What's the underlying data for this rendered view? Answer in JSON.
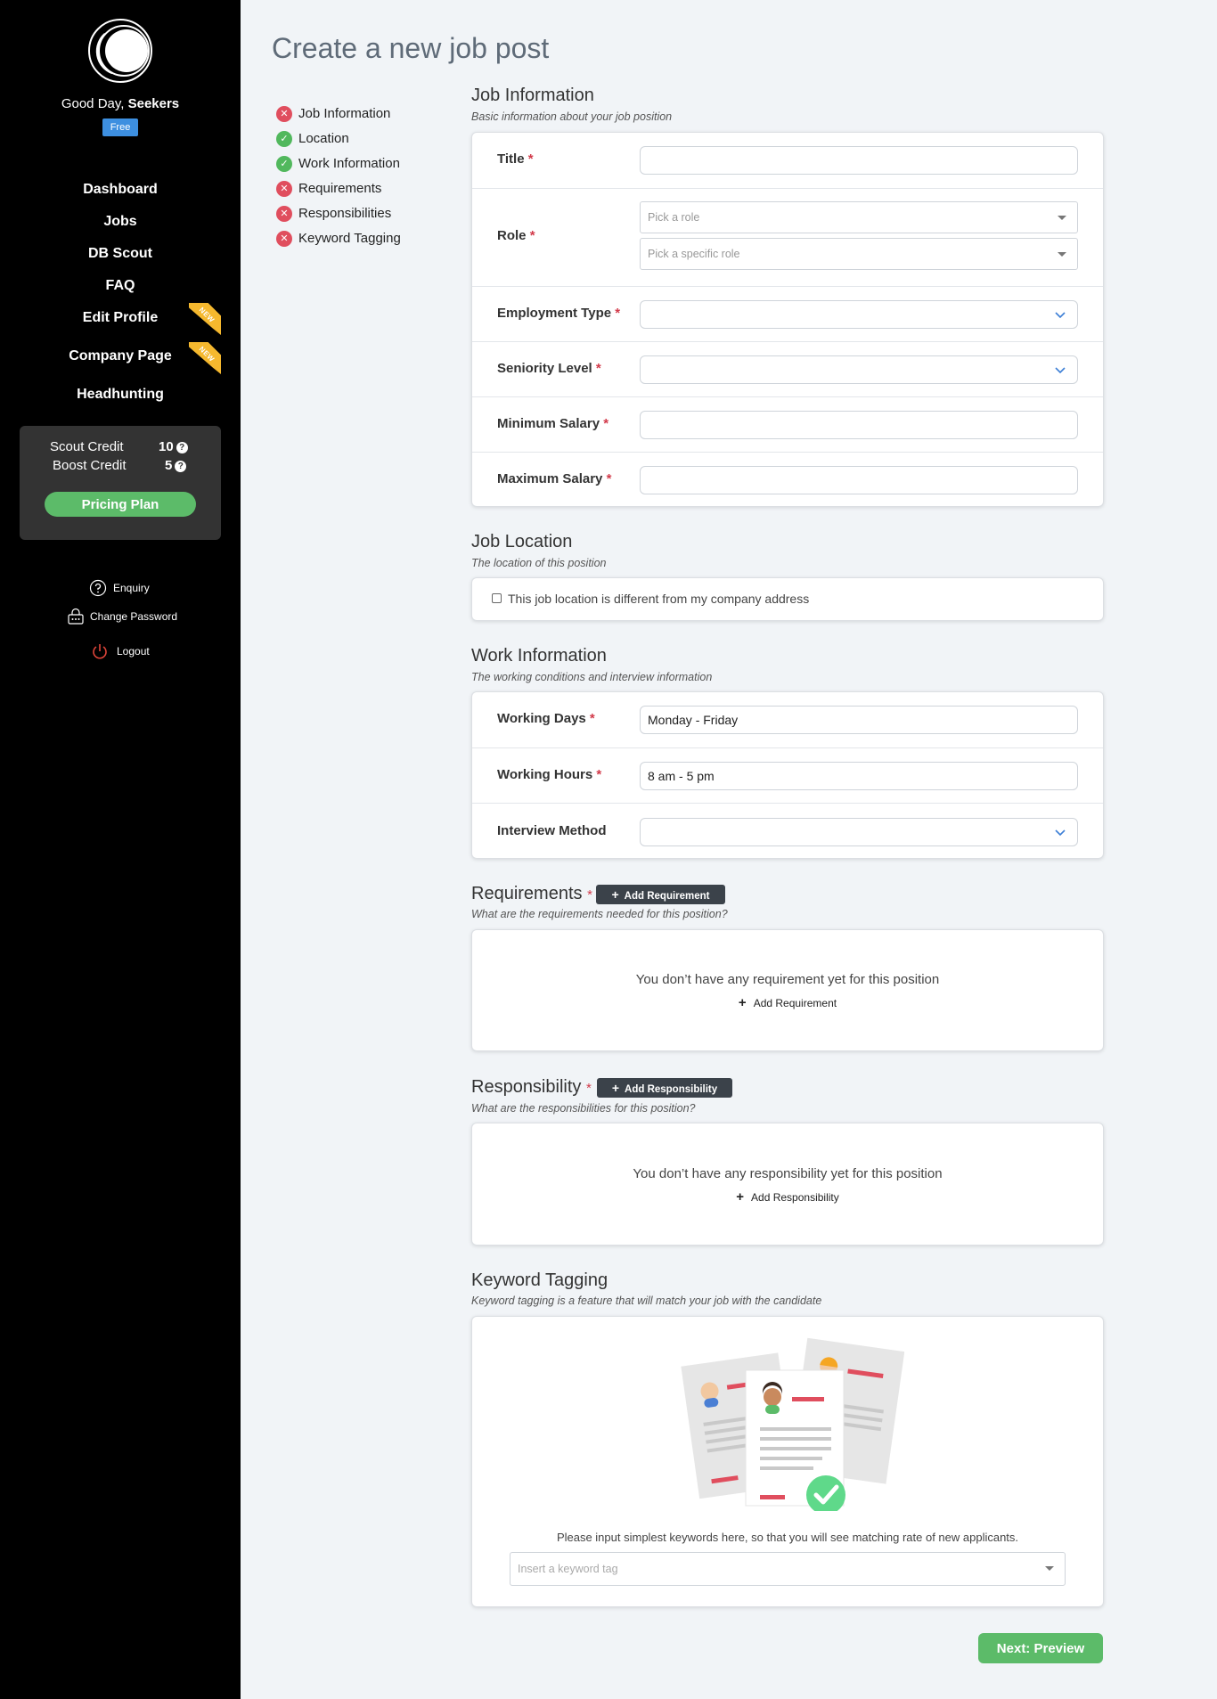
{
  "sidebar": {
    "greeting_prefix": "Good Day,",
    "user_name": "Seekers",
    "plan_badge": "Free",
    "nav": [
      {
        "label": "Dashboard"
      },
      {
        "label": "Jobs"
      },
      {
        "label": "DB Scout"
      },
      {
        "label": "FAQ"
      },
      {
        "label": "Edit Profile",
        "badge": "NEW"
      },
      {
        "label": "Company Page",
        "badge": "NEW"
      },
      {
        "label": "Headhunting"
      }
    ],
    "credits": {
      "scout_label": "Scout Credit",
      "scout_value": "10",
      "boost_label": "Boost Credit",
      "boost_value": "5",
      "pricing_button": "Pricing Plan"
    },
    "links": {
      "enquiry": "Enquiry",
      "change_password": "Change Password",
      "logout": "Logout"
    }
  },
  "page": {
    "title": "Create a new job post"
  },
  "steps": [
    {
      "label": "Job Information",
      "status": "incomplete"
    },
    {
      "label": "Location",
      "status": "complete"
    },
    {
      "label": "Work Information",
      "status": "complete"
    },
    {
      "label": "Requirements",
      "status": "incomplete"
    },
    {
      "label": "Responsibilities",
      "status": "incomplete"
    },
    {
      "label": "Keyword Tagging",
      "status": "incomplete"
    }
  ],
  "job_info": {
    "title": "Job Information",
    "subtitle": "Basic information about your job position",
    "fields": {
      "title_label": "Title",
      "role_label": "Role",
      "role_placeholder": "Pick a role",
      "specific_role_placeholder": "Pick a specific role",
      "employment_type_label": "Employment Type",
      "seniority_label": "Seniority Level",
      "min_salary_label": "Minimum Salary",
      "max_salary_label": "Maximum Salary"
    },
    "required_mark": "*"
  },
  "job_location": {
    "title": "Job Location",
    "subtitle": "The location of this position",
    "checkbox_label": "This job location is different from my company address"
  },
  "work_info": {
    "title": "Work Information",
    "subtitle": "The working conditions and interview information",
    "working_days_label": "Working Days",
    "working_days_value": "Monday - Friday",
    "working_hours_label": "Working Hours",
    "working_hours_value": "8 am - 5 pm",
    "interview_method_label": "Interview Method"
  },
  "requirements": {
    "title": "Requirements",
    "add_button": "Add Requirement",
    "subtitle": "What are the requirements needed for this position?",
    "empty_message": "You don’t have any requirement yet for this position",
    "empty_link": "Add Requirement"
  },
  "responsibility": {
    "title": "Responsibility",
    "add_button": "Add Responsibility",
    "subtitle": "What are the responsibilities for this position?",
    "empty_message": "You don’t have any responsibility yet for this position",
    "empty_link": "Add Responsibility"
  },
  "keyword": {
    "title": "Keyword Tagging",
    "subtitle": "Keyword tagging is a feature that will match your job with the candidate",
    "hint": "Please input simplest keywords here, so that you will see matching rate of new applicants.",
    "placeholder": "Insert a keyword tag"
  },
  "footer": {
    "next_button": "Next: Preview"
  },
  "colors": {
    "sidebar_bg": "#000000",
    "accent_green": "#5cbb69",
    "error_red": "#e04e5e",
    "badge_blue": "#3d8fe0",
    "ribbon_yellow": "#f5b82e"
  }
}
